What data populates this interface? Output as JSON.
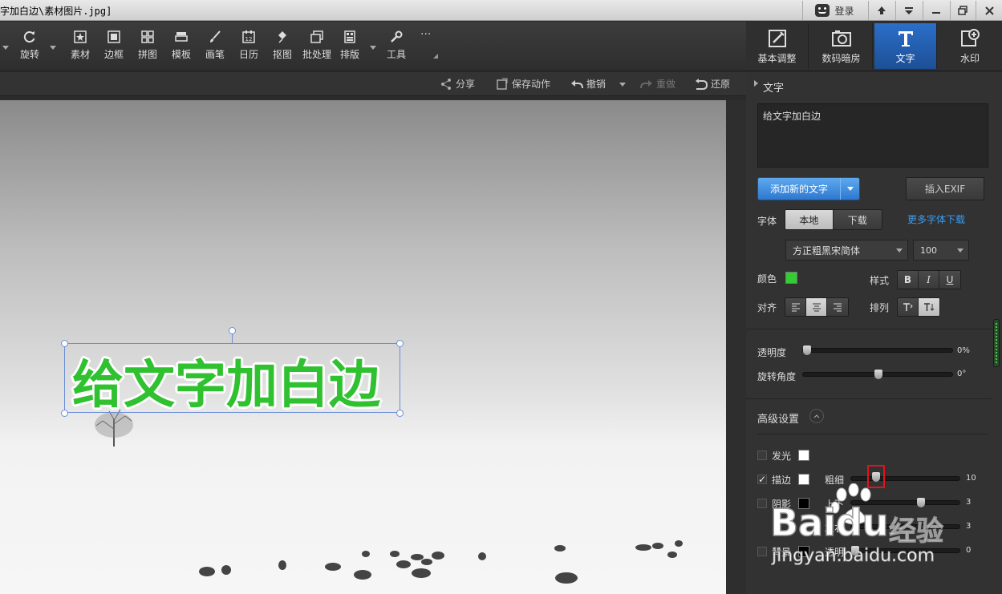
{
  "titlebar": {
    "title": "字加白边\\素材图片.jpg]",
    "login": "登录"
  },
  "toolbar": {
    "items": [
      {
        "label": "旋转",
        "icon": "rotate-icon"
      },
      {
        "label": "素材",
        "icon": "star-icon"
      },
      {
        "label": "边框",
        "icon": "frame-icon"
      },
      {
        "label": "拼图",
        "icon": "grid-icon"
      },
      {
        "label": "模板",
        "icon": "template-icon"
      },
      {
        "label": "画笔",
        "icon": "brush-icon"
      },
      {
        "label": "日历",
        "icon": "calendar-icon"
      },
      {
        "label": "抠图",
        "icon": "pen-icon"
      },
      {
        "label": "批处理",
        "icon": "batch-icon"
      },
      {
        "label": "排版",
        "icon": "layout-icon"
      },
      {
        "label": "工具",
        "icon": "wrench-icon"
      },
      {
        "label": "···",
        "icon": "more-icon"
      }
    ],
    "calendar_day": "12"
  },
  "right_tabs": [
    {
      "label": "基本调整",
      "icon": "adjust-icon"
    },
    {
      "label": "数码暗房",
      "icon": "camera-icon"
    },
    {
      "label": "文字",
      "icon": "text-icon",
      "active": true
    },
    {
      "label": "水印",
      "icon": "watermark-icon"
    }
  ],
  "actions": {
    "share": "分享",
    "save_action": "保存动作",
    "undo": "撤销",
    "redo": "重做",
    "restore": "还原"
  },
  "canvas": {
    "overlay_text": "给文字加白边",
    "text_color": "#2fc12f"
  },
  "panel": {
    "section_title": "文字",
    "text_value": "给文字加白边",
    "add_text_button": "添加新的文字",
    "insert_exif_button": "插入EXIF",
    "font_label": "字体",
    "font_tab_local": "本地",
    "font_tab_download": "下载",
    "more_fonts_link": "更多字体下载",
    "font_name": "方正粗黑宋简体",
    "font_size": "100",
    "color_label": "颜色",
    "color_value": "#33cc33",
    "style_label": "样式",
    "style_bold": "B",
    "style_italic": "I",
    "style_underline": "U",
    "align_label": "对齐",
    "arrange_label": "排列",
    "opacity_label": "透明度",
    "opacity_value": "0%",
    "opacity_level": 0,
    "rotation_label": "旋转角度",
    "rotation_value": "0°",
    "rotation_level": 0.5,
    "advanced_title": "高级设置",
    "glow_label": "发光",
    "stroke_label": "描边",
    "stroke_checked": "✓",
    "thickness_label": "粗细",
    "thickness_value": "10",
    "shadow_label": "阴影",
    "shadow_up_label": "上下",
    "shadow_up_value": "3",
    "shadow_lr_label": "左右",
    "shadow_lr_value": "3",
    "bg_label": "背景",
    "bg_alpha_label": "透明",
    "bg_alpha_value": "0"
  },
  "watermark": {
    "brand": "Baidu",
    "brand_cn": "经验",
    "url": "jingyan.baidu.com"
  }
}
